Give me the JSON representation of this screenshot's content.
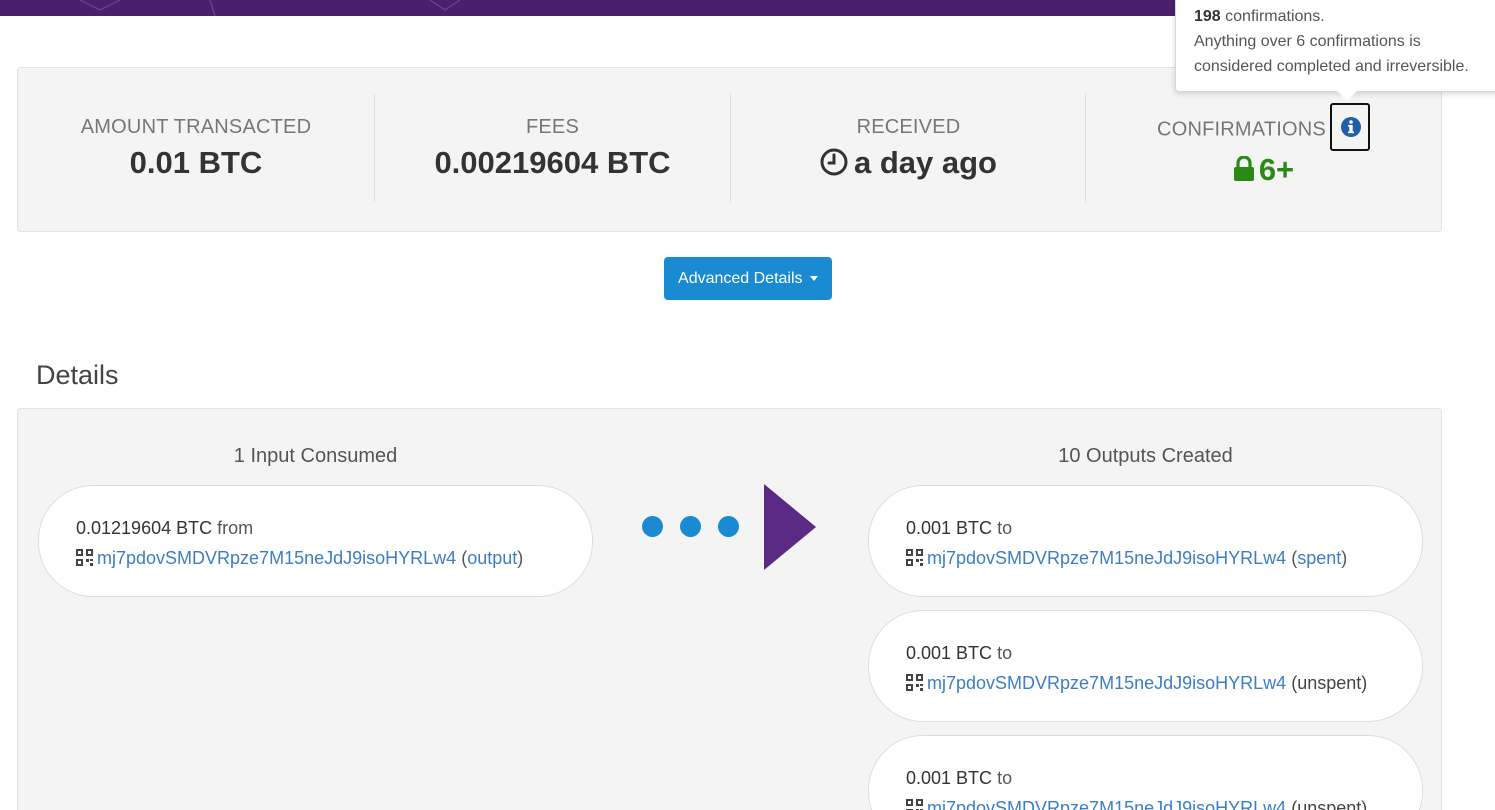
{
  "summary": {
    "amount": {
      "label": "AMOUNT TRANSACTED",
      "value": "0.01 BTC"
    },
    "fees": {
      "label": "FEES",
      "value": "0.00219604 BTC"
    },
    "received": {
      "label": "RECEIVED",
      "value": "a day ago",
      "icon": "clock-icon"
    },
    "confirmations": {
      "label": "CONFIRMATIONS",
      "value": "6+",
      "icon": "lock-icon",
      "info_icon": "info-icon",
      "color": "#2a8a15"
    }
  },
  "tooltip": {
    "count": "198",
    "count_suffix": " confirmations.",
    "line2": "Anything over 6 confirmations is",
    "line3": "considered completed and irreversible."
  },
  "advanced_button": {
    "label": "Advanced Details"
  },
  "details": {
    "title": "Details",
    "inputs_title": "1 Input Consumed",
    "outputs_title": "10 Outputs Created",
    "inputs": [
      {
        "amount": "0.01219604 BTC",
        "word": "from",
        "address": "mj7pdovSMDVRpze7M15neJdJ9isoHYRLw4",
        "status": "output",
        "status_link": true
      }
    ],
    "outputs": [
      {
        "amount": "0.001 BTC",
        "word": "to",
        "address": "mj7pdovSMDVRpze7M15neJdJ9isoHYRLw4",
        "status": "spent",
        "status_link": true
      },
      {
        "amount": "0.001 BTC",
        "word": "to",
        "address": "mj7pdovSMDVRpze7M15neJdJ9isoHYRLw4",
        "status": "unspent",
        "status_link": false
      },
      {
        "amount": "0.001 BTC",
        "word": "to",
        "address": "mj7pdovSMDVRpze7M15neJdJ9isoHYRLw4",
        "status": "unspent",
        "status_link": false
      }
    ]
  },
  "colors": {
    "brand": "#4a1f6b",
    "accent": "#1a8ad3",
    "link": "#3b7ec4",
    "confirm_green": "#2a8a15"
  }
}
